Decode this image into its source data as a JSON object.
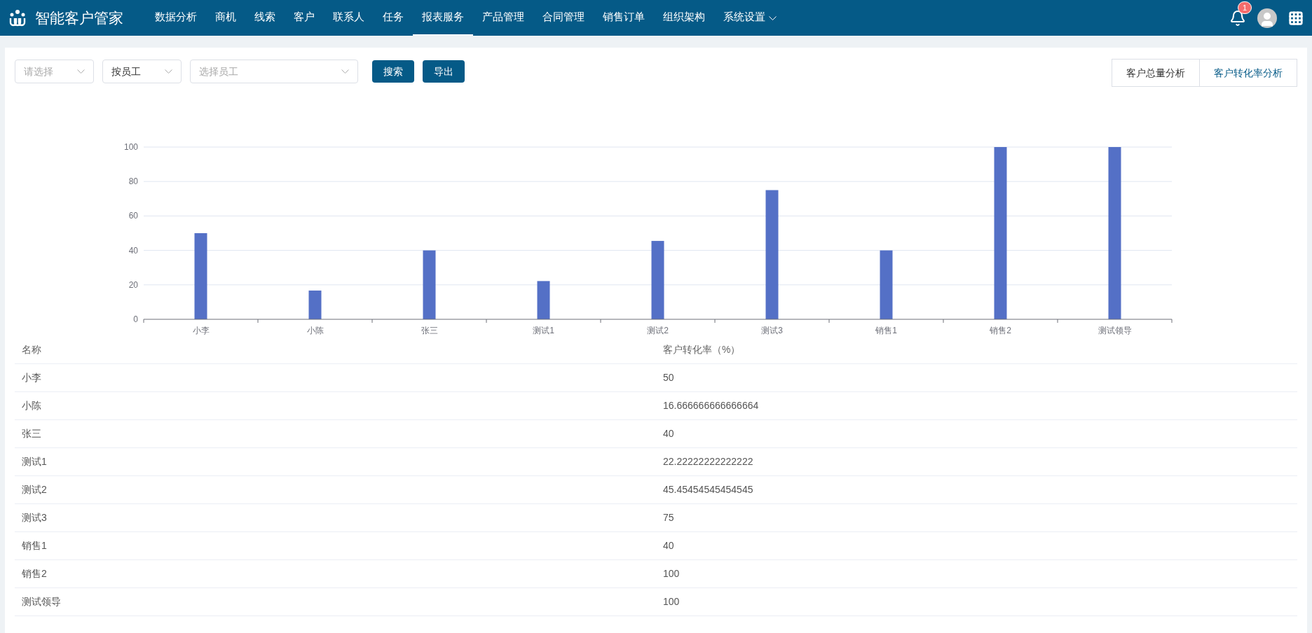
{
  "app": {
    "title": "智能客户管家",
    "notification_count": "1"
  },
  "nav": [
    {
      "kind": "link",
      "label": "数据分析",
      "selected": false
    },
    {
      "kind": "link",
      "label": "商机",
      "selected": false
    },
    {
      "kind": "link",
      "label": "线索",
      "selected": false
    },
    {
      "kind": "link",
      "label": "客户",
      "selected": false
    },
    {
      "kind": "link",
      "label": "联系人",
      "selected": false
    },
    {
      "kind": "link",
      "label": "任务",
      "selected": false
    },
    {
      "kind": "link",
      "label": "报表服务",
      "selected": true
    },
    {
      "kind": "link",
      "label": "产品管理",
      "selected": false
    },
    {
      "kind": "link",
      "label": "合同管理",
      "selected": false
    },
    {
      "kind": "link",
      "label": "销售订单",
      "selected": false
    },
    {
      "kind": "link",
      "label": "组织架构",
      "selected": false
    },
    {
      "kind": "menu",
      "label": "系统设置",
      "selected": false
    }
  ],
  "filters": [
    {
      "kind": "select",
      "placeholder": "请选择"
    },
    {
      "kind": "select",
      "value": "按员工"
    },
    {
      "kind": "select",
      "placeholder": "选择员工"
    }
  ],
  "buttons": [
    "搜索",
    "导出"
  ],
  "view_tabs": [
    {
      "label": "客户总量分析",
      "selected": false
    },
    {
      "label": "客户转化率分析",
      "selected": true
    }
  ],
  "chart": {
    "chart_data": {
      "type": "bar",
      "categories": [
        "小李",
        "小陈",
        "张三",
        "测试1",
        "测试2",
        "测试3",
        "销售1",
        "销售2",
        "测试领导"
      ],
      "series": [
        {
          "color": "#5470c6",
          "values": [
            50,
            16.7,
            40,
            22.2,
            45.5,
            75,
            40,
            100,
            100
          ]
        }
      ],
      "ylim": [
        0,
        100
      ],
      "yticks": [
        0,
        20,
        40,
        60,
        80,
        100
      ],
      "grid": true
    }
  },
  "table": {
    "columns": [
      "名称",
      "客户转化率（%）"
    ],
    "rows": [
      [
        "小李",
        "50"
      ],
      [
        "小陈",
        "16.666666666666664"
      ],
      [
        "张三",
        "40"
      ],
      [
        "测试1",
        "22.22222222222222"
      ],
      [
        "测试2",
        "45.45454545454545"
      ],
      [
        "测试3",
        "75"
      ],
      [
        "销售1",
        "40"
      ],
      [
        "销售2",
        "100"
      ],
      [
        "测试领导",
        "100"
      ]
    ]
  }
}
